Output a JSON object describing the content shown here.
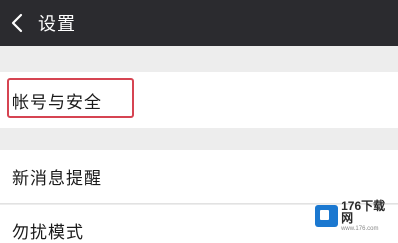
{
  "header": {
    "title": "设置",
    "back_icon": "chevron-left-icon"
  },
  "settings": {
    "items": [
      {
        "label": "帐号与安全",
        "highlighted": true
      },
      {
        "label": "新消息提醒"
      },
      {
        "label": "勿扰模式"
      }
    ]
  },
  "watermark": {
    "brand": "176下载网",
    "url": "www.176.com"
  },
  "colors": {
    "title_bar": "#2b2b2f",
    "background": "#ededed",
    "row": "#ffffff",
    "highlight": "#d64452",
    "watermark_logo": "#1b78d0"
  }
}
